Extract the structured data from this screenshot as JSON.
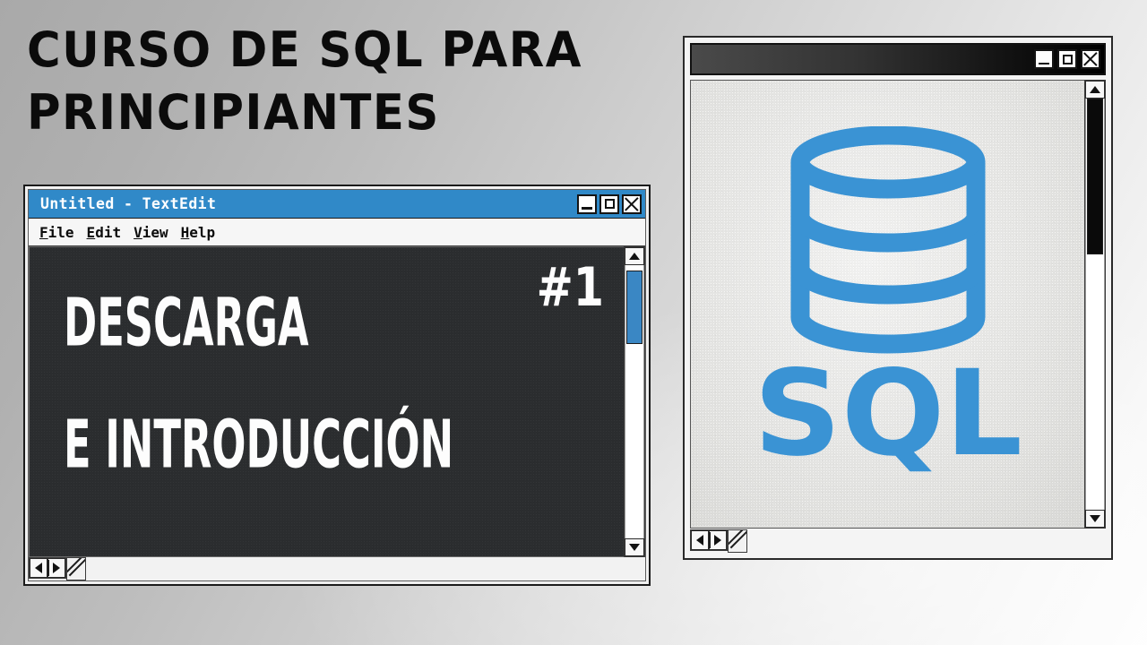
{
  "theme": {
    "accent_blue": "#3089c8",
    "logo_blue": "#3a93d4",
    "slide_bg": "#2b2d2f",
    "title_text_color": "#ffffff",
    "heading_color": "#0b0b0b",
    "paper_bg": "#e3e3e1"
  },
  "heading": {
    "line1": "CURSO DE SQL PARA",
    "line2": "PRINCIPIANTES"
  },
  "textedit_window": {
    "title": "Untitled - TextEdit",
    "menus": [
      {
        "mnemonic": "F",
        "rest": "ile"
      },
      {
        "mnemonic": "E",
        "rest": "dit"
      },
      {
        "mnemonic": "V",
        "rest": "iew"
      },
      {
        "mnemonic": "H",
        "rest": "elp"
      }
    ],
    "window_buttons": {
      "minimize": "minimize-icon",
      "maximize": "maximize-icon",
      "close": "close-icon"
    },
    "slide": {
      "line1": "DESCARGA",
      "line2": "E INTRODUCCIÓN",
      "episode_badge": "#1"
    },
    "scrollbars": {
      "vertical": {
        "thumb_color": "#3a87c4",
        "thumb_top_percent": 2,
        "thumb_height_percent": 27,
        "up_arrow": "scroll-up-icon",
        "down_arrow": "scroll-down-icon"
      },
      "horizontal": {
        "thumb_color": "#3a87c4",
        "thumb_left_percent": 0,
        "thumb_width_percent": 16,
        "left_arrow": "scroll-left-icon",
        "right_arrow": "scroll-right-icon"
      }
    },
    "resize_grip": "resize-grip-icon"
  },
  "sql_viewer_window": {
    "title": "",
    "window_buttons": {
      "minimize": "minimize-icon",
      "maximize": "maximize-icon",
      "close": "close-icon"
    },
    "content": {
      "database_icon": "database-cylinder-icon",
      "wordmark": "SQL"
    },
    "scrollbars": {
      "vertical": {
        "thumb_color": "#0a0a0a",
        "thumb_top_percent": 0,
        "thumb_height_percent": 38,
        "up_arrow": "scroll-up-icon",
        "down_arrow": "scroll-down-icon"
      },
      "horizontal": {
        "thumb_color": "#3a3a3a",
        "thumb_left_percent": 0,
        "thumb_width_percent": 40,
        "left_arrow": "scroll-left-icon",
        "right_arrow": "scroll-right-icon"
      }
    },
    "resize_grip": "resize-grip-icon"
  }
}
